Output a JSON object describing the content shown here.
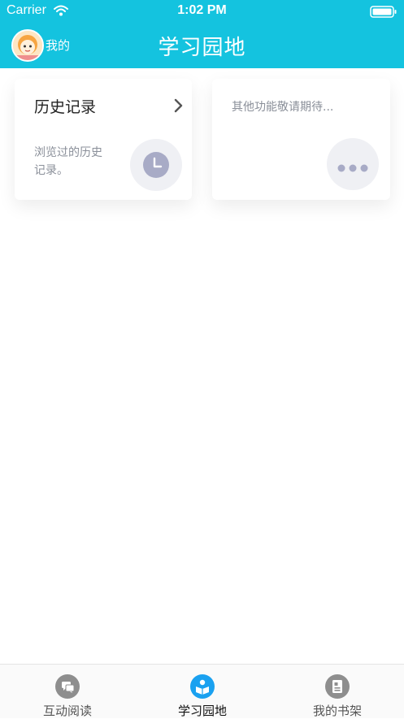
{
  "status_bar": {
    "carrier": "Carrier",
    "time": "1:02 PM"
  },
  "header": {
    "me_label": "我的",
    "title": "学习园地"
  },
  "cards": {
    "history": {
      "title": "历史记录",
      "description": "浏览过的历史记录。",
      "icon": "clock-icon"
    },
    "more": {
      "text": "其他功能敬请期待...",
      "icon": "more-dots-icon"
    }
  },
  "tabbar": {
    "tabs": [
      {
        "label": "互动阅读",
        "icon": "chat-icon",
        "active": false
      },
      {
        "label": "学习园地",
        "icon": "book-reader-icon",
        "active": true
      },
      {
        "label": "我的书架",
        "icon": "bookshelf-icon",
        "active": false
      }
    ]
  },
  "colors": {
    "header": "#14c3df",
    "active_tab_icon": "#1aa1f0",
    "inactive_tab_icon": "#8e8e8e",
    "card_icon": "#a8abc6",
    "muted_text": "#8a8f99"
  }
}
